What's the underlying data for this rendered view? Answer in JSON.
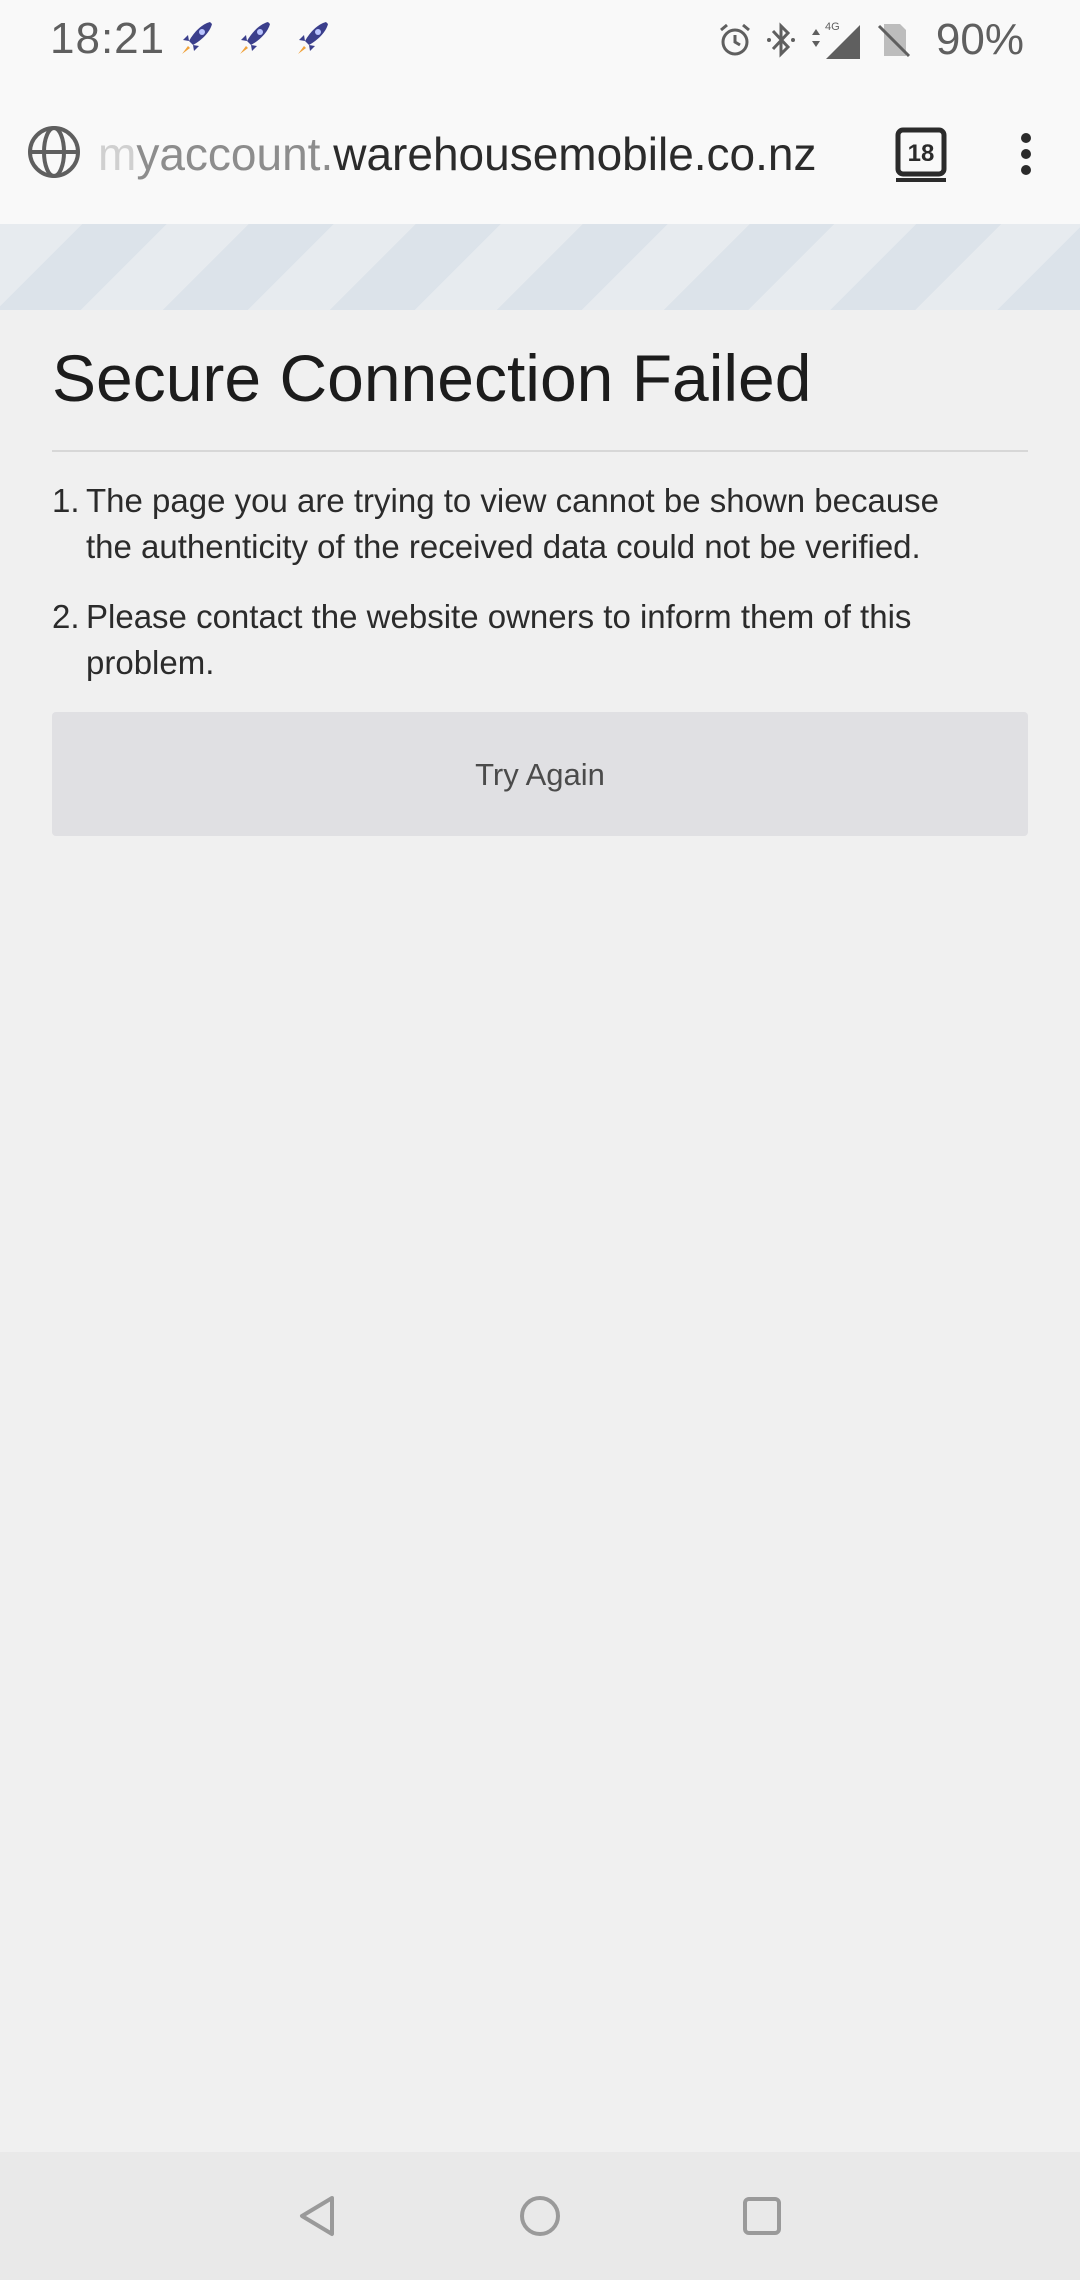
{
  "status_bar": {
    "time": "18:21",
    "notification_icons": [
      "rocket-icon",
      "rocket-icon",
      "rocket-icon"
    ],
    "system_icons": [
      "alarm-icon",
      "bluetooth-icon",
      "signal-4g-icon",
      "no-sim-icon"
    ],
    "network_label": "4G",
    "battery": "90%"
  },
  "browser": {
    "url_prefix": "m",
    "url_subdomain": "yaccount.",
    "url_domain": "warehousemobile.co.nz",
    "tab_count": "18"
  },
  "error_page": {
    "title": "Secure Connection Failed",
    "messages": [
      {
        "num": "1.",
        "text": "The page you are trying to view cannot be shown because the authenticity of the received data could not be verified."
      },
      {
        "num": "2.",
        "text": "Please contact the website owners to inform them of this problem."
      }
    ],
    "try_again_label": "Try Again"
  },
  "colors": {
    "background": "#f0f0f0",
    "button_bg": "#e0e0e3",
    "stripe_light": "#e7ebef",
    "stripe_dark": "#dce3ea"
  }
}
